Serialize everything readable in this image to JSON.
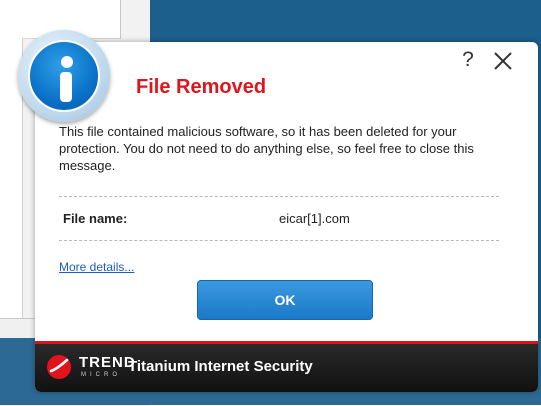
{
  "dialog": {
    "title": "File Removed",
    "help_label": "?",
    "message": "This file contained malicious software, so it has been deleted for your protection. You do not need to do anything else, so feel free to close this message.",
    "file_label": "File name:",
    "file_value": "eicar[1].com",
    "more_details_label": "More details...",
    "ok_label": "OK",
    "title_color": "#e1141c",
    "accent_color": "#1b79c8"
  },
  "footer": {
    "brand_word": "TREND",
    "brand_sub": "MICRO",
    "product_name": "Titanium Internet Security",
    "brand_color": "#d8141c"
  },
  "icons": {
    "info": "info-icon",
    "close": "close-icon",
    "logo": "trend-micro-logo-icon"
  }
}
